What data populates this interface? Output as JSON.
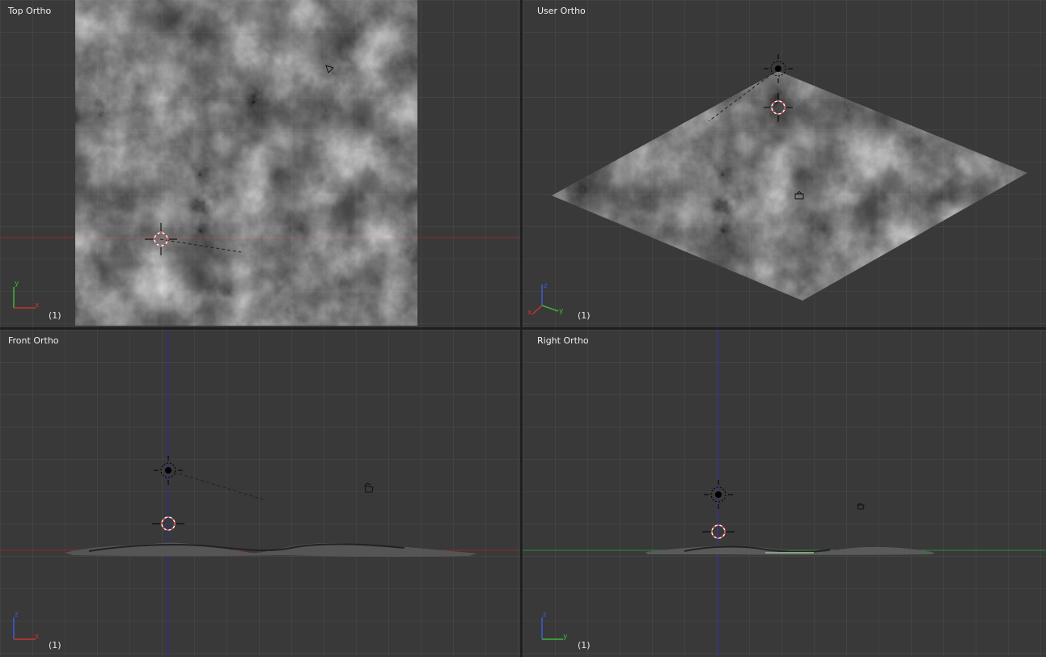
{
  "viewports": {
    "top": {
      "title": "Top Ortho",
      "frame": "(1)",
      "axes": [
        "x",
        "y"
      ]
    },
    "user": {
      "title": "User Ortho",
      "frame": "(1)",
      "axes": [
        "x",
        "y",
        "z"
      ]
    },
    "front": {
      "title": "Front Ortho",
      "frame": "(1)",
      "axes": [
        "x",
        "z"
      ]
    },
    "right": {
      "title": "Right Ortho",
      "frame": "(1)",
      "axes": [
        "y",
        "z"
      ]
    }
  },
  "colors": {
    "background": "#393939",
    "x_axis": "#c83232",
    "y_axis": "#3cb43c",
    "z_axis": "#3c5ad2",
    "cursor_ring": "#d33c3c"
  },
  "icons": [
    "lamp-icon",
    "camera-icon",
    "3d-cursor-icon",
    "terrain-mesh"
  ]
}
